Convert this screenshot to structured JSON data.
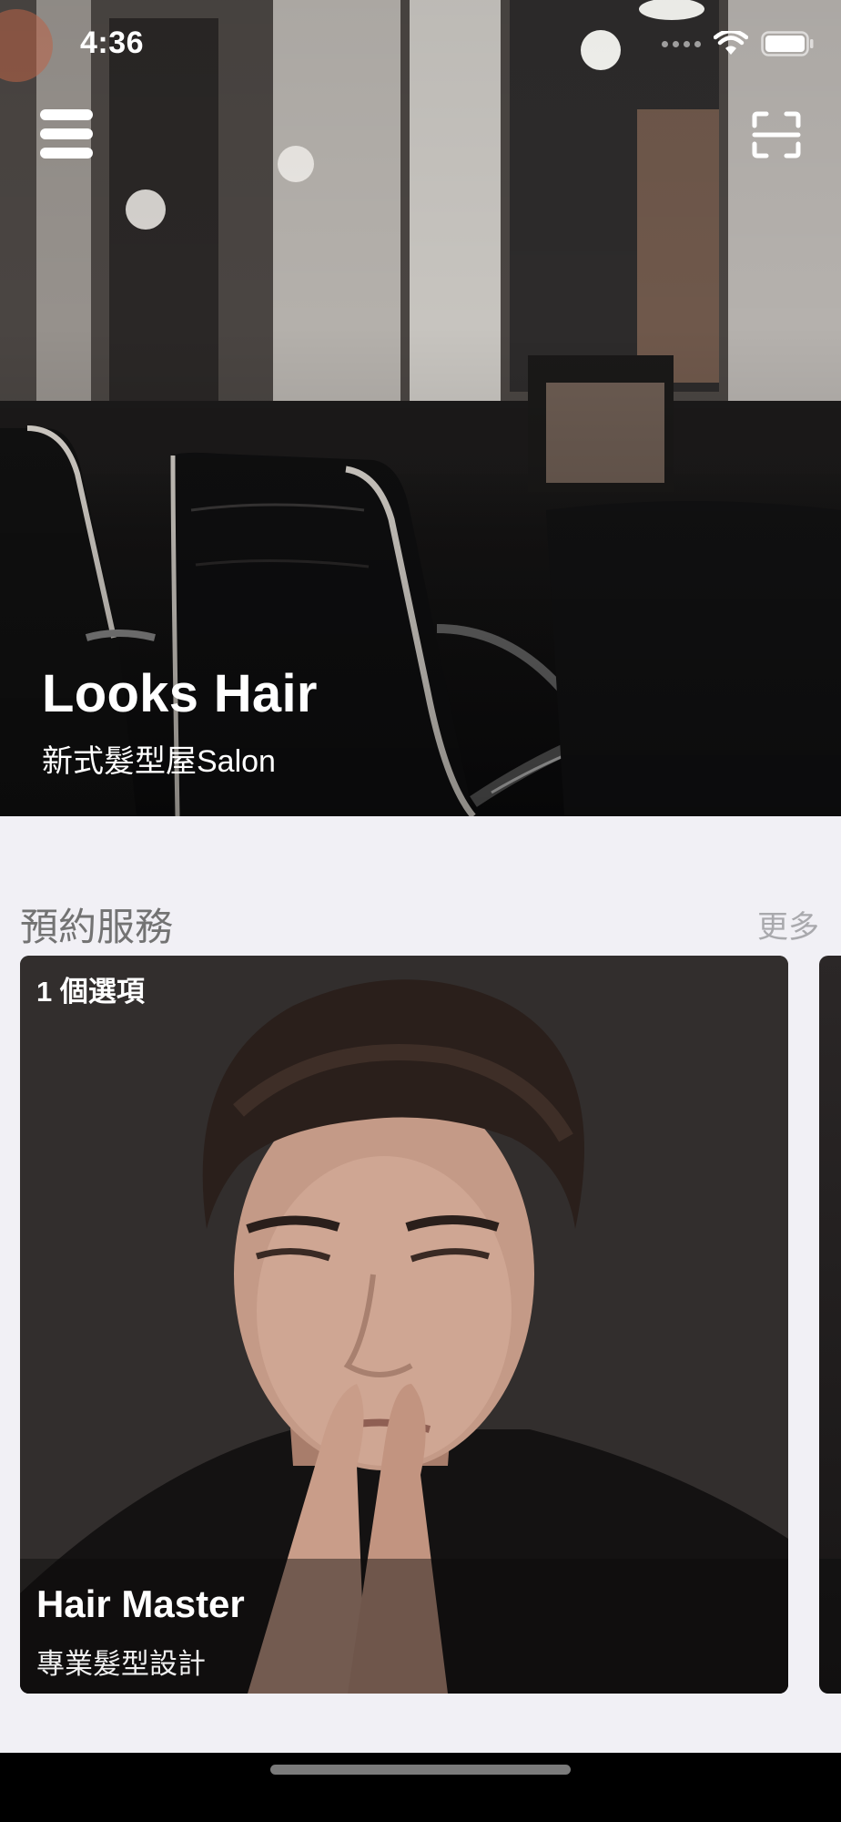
{
  "status_bar": {
    "time": "4:36",
    "icons": [
      "signal-dots-icon",
      "wifi-icon",
      "battery-icon"
    ]
  },
  "header": {
    "menu_icon": "hamburger-menu-icon",
    "scan_icon": "scan-frame-icon"
  },
  "hero": {
    "title": "Looks Hair",
    "subtitle": "新式髮型屋Salon",
    "image": "salon-interior-photo"
  },
  "section": {
    "title": "預約服務",
    "more_label": "更多"
  },
  "cards": [
    {
      "badge": "1 個選項",
      "title": "Hair Master",
      "subtitle": "專業髮型設計",
      "image": "stylist-portrait-photo"
    }
  ],
  "colors": {
    "background": "#f1f0f5",
    "section_title": "#737373",
    "more_link": "#a9a9ad",
    "text_on_image": "#ffffff"
  }
}
